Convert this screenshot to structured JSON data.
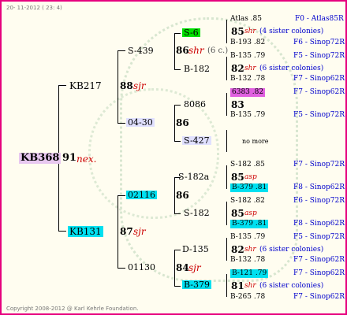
{
  "date": "20- 11-2012 ( 23: 4)",
  "copyright": "Copyright 2008-2012 @ Karl Kehrle Foundation.",
  "g1": {
    "id": "KB368",
    "year": "91",
    "ann": "nex."
  },
  "g2": [
    {
      "id": "KB217",
      "year": ""
    },
    {
      "id": "KB131",
      "year": ""
    }
  ],
  "g3": [
    {
      "id": "S-439",
      "year": ""
    },
    {
      "id": "04-30",
      "year": ""
    },
    {
      "id": "02116",
      "year": ""
    },
    {
      "id": "01130",
      "year": ""
    }
  ],
  "g2_years": {
    "a": "88",
    "a_ann": "sjr",
    "b": "87",
    "b_ann": "sjr"
  },
  "g3_years": {
    "a": "86",
    "a_ann": "shr",
    "a_extra": "(6 c.)",
    "b": "86",
    "c": "86",
    "d": "84",
    "d_ann": "sjr"
  },
  "g4": [
    {
      "id": "S-6"
    },
    {
      "id": "B-182"
    },
    {
      "id": "8086"
    },
    {
      "id": "S-427"
    },
    {
      "id": "S-182a"
    },
    {
      "id": "S-182"
    },
    {
      "id": "D-135"
    },
    {
      "id": "B-379"
    }
  ],
  "g5": [
    {
      "line": "Atlas .85",
      "origin": "F0 - Atlas85R"
    },
    {
      "year": "85",
      "ann": "shr",
      "note": "(4 sister colonies)"
    },
    {
      "line": "B-193 .82",
      "origin": "F6 - Sinop72R"
    },
    {
      "line": "B-135 .79",
      "origin": "F5 - Sinop72R"
    },
    {
      "year": "82",
      "ann": "shr",
      "note": "(6 sister colonies)"
    },
    {
      "line": "B-132 .78",
      "origin": "F7 - Sinop62R"
    },
    {
      "line": "6383 .82",
      "origin": "F7 - Sinop62R"
    },
    {
      "year": "83"
    },
    {
      "line": "B-135 .79",
      "origin": "F5 - Sinop72R"
    },
    {
      "note": "no more"
    },
    {
      "line": "S-182 .85",
      "origin": "F7 - Sinop72R"
    },
    {
      "year": "85",
      "ann": "asp"
    },
    {
      "line": "B-379 .81",
      "origin": "F8 - Sinop62R"
    },
    {
      "line": "S-182 .82",
      "origin": "F6 - Sinop72R"
    },
    {
      "year": "85",
      "ann": "asp"
    },
    {
      "line": "B-379 .81",
      "origin": "F8 - Sinop62R"
    },
    {
      "line": "B-135 .79",
      "origin": "F5 - Sinop72R"
    },
    {
      "year": "82",
      "ann": "shr",
      "note": "(6 sister colonies)"
    },
    {
      "line": "B-132 .78",
      "origin": "F7 - Sinop62R"
    },
    {
      "line": "B-121 .79",
      "origin": "F7 - Sinop62R"
    },
    {
      "year": "81",
      "ann": "shr",
      "note": "(6 sister colonies)"
    },
    {
      "line": "B-265 .78",
      "origin": "F7 - Sinop62R"
    }
  ]
}
